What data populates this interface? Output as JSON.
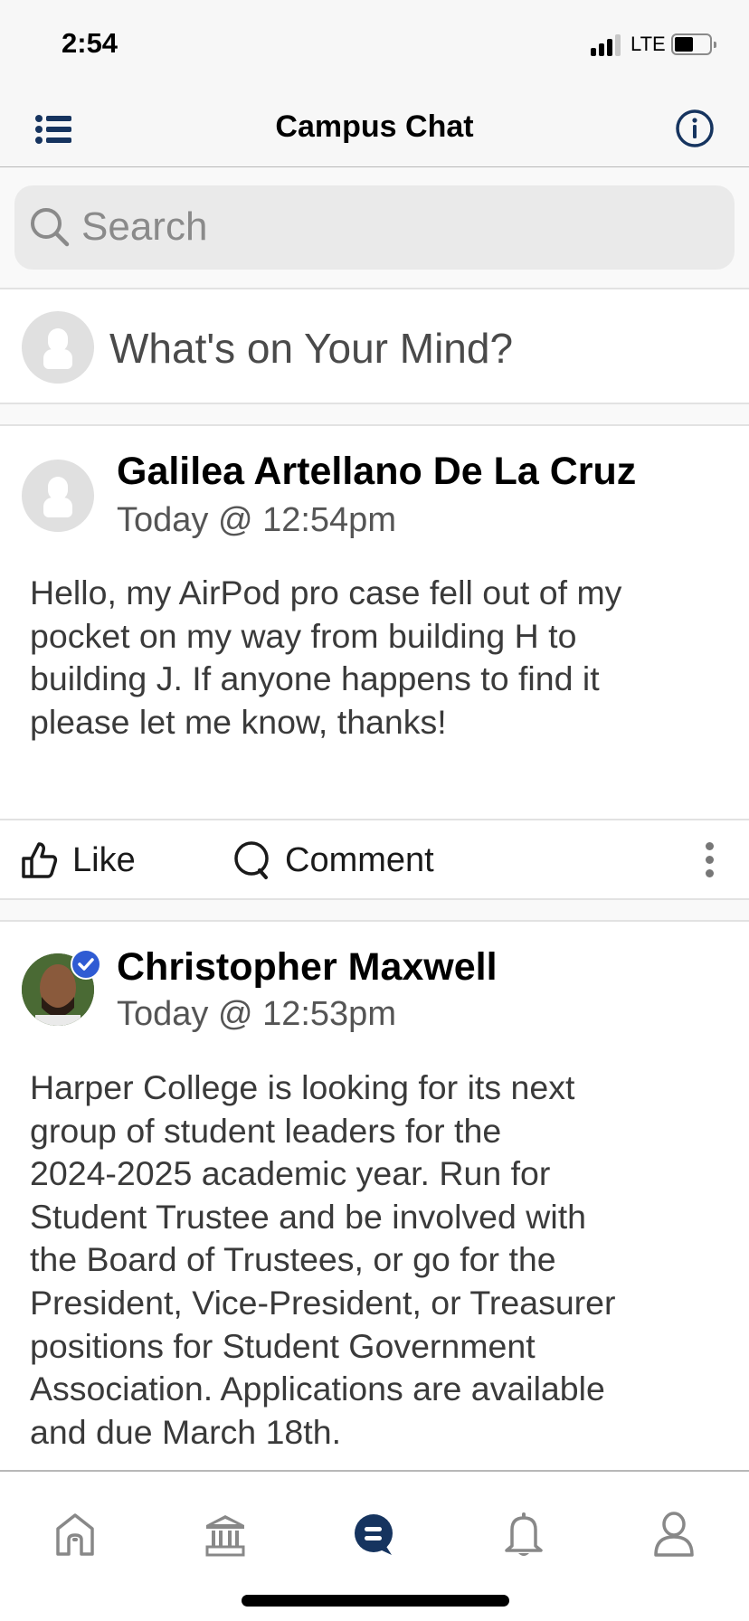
{
  "status_bar": {
    "time": "2:54",
    "network": "LTE",
    "battery_percent": 45
  },
  "navbar": {
    "title": "Campus Chat",
    "menu_icon": "list-icon",
    "info_icon": "info-icon"
  },
  "search": {
    "placeholder": "Search",
    "value": ""
  },
  "composer": {
    "prompt": "What's on Your Mind?"
  },
  "posts": [
    {
      "author": "Galilea Artellano De La Cruz",
      "timestamp": "Today @ 12:54pm",
      "verified": false,
      "avatar": "default-avatar",
      "body": "Hello, my AirPod pro case fell out of my\npocket on my way from building H to\nbuilding J. If anyone happens to find it\nplease let me know, thanks!",
      "actions": {
        "like_label": "Like",
        "comment_label": "Comment"
      }
    },
    {
      "author": "Christopher Maxwell",
      "timestamp": "Today @ 12:53pm",
      "verified": true,
      "avatar": "profile-photo",
      "body": "Harper College is looking for its next\ngroup of student leaders for the\n2024-2025 academic year.  Run for\nStudent Trustee and be involved with\nthe Board of Trustees, or go for the\nPresident, Vice-President, or Treasurer\npositions for Student Government\nAssociation.  Applications are available\nand due March 18th."
    }
  ],
  "tabbar": {
    "tabs": [
      {
        "name": "home",
        "icon": "home-icon",
        "active": false
      },
      {
        "name": "campus",
        "icon": "institution-icon",
        "active": false
      },
      {
        "name": "chat",
        "icon": "chat-icon",
        "active": true
      },
      {
        "name": "notifications",
        "icon": "bell-icon",
        "active": false
      },
      {
        "name": "profile",
        "icon": "person-icon",
        "active": false
      }
    ]
  },
  "colors": {
    "accent": "#16345f",
    "inactive_icon": "#888888",
    "verified": "#2f5bd3"
  }
}
